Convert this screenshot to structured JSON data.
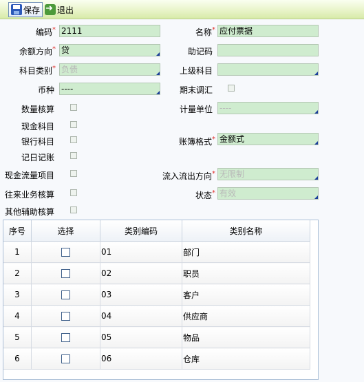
{
  "toolbar": {
    "save_label": "保存",
    "exit_label": "退出"
  },
  "form": {
    "code_label": "编码",
    "code_value": "2111",
    "name_label": "名称",
    "name_value": "应付票据",
    "balance_dir_label": "余额方向",
    "balance_dir_value": "贷",
    "mnemonic_label": "助记码",
    "mnemonic_value": "",
    "subject_type_label": "科目类别",
    "subject_type_value": "负债",
    "parent_subject_label": "上级科目",
    "parent_subject_value": "",
    "currency_label": "币种",
    "currency_value": "----",
    "period_end_adjust_label": "期末调汇",
    "quantity_check_label": "数量核算",
    "unit_label": "计量单位",
    "unit_value": "----",
    "cash_subject_label": "现金科目",
    "bank_subject_label": "银行科目",
    "ledger_format_label": "账簿格式",
    "ledger_format_value": "金额式",
    "daily_journal_label": "记日记账",
    "cashflow_item_label": "现金流量项目",
    "flow_direction_label": "流入流出方向",
    "flow_direction_value": "无限制",
    "contact_check_label": "往来业务核算",
    "status_label": "状态",
    "status_value": "有效",
    "other_aux_label": "其他辅助核算"
  },
  "grid": {
    "headers": [
      "序号",
      "选择",
      "类别编码",
      "类别名称"
    ],
    "rows": [
      {
        "no": "1",
        "code": "01",
        "name": "部门"
      },
      {
        "no": "2",
        "code": "02",
        "name": "职员"
      },
      {
        "no": "3",
        "code": "03",
        "name": "客户"
      },
      {
        "no": "4",
        "code": "04",
        "name": "供应商"
      },
      {
        "no": "5",
        "code": "05",
        "name": "物品"
      },
      {
        "no": "6",
        "code": "06",
        "name": "仓库"
      }
    ]
  }
}
